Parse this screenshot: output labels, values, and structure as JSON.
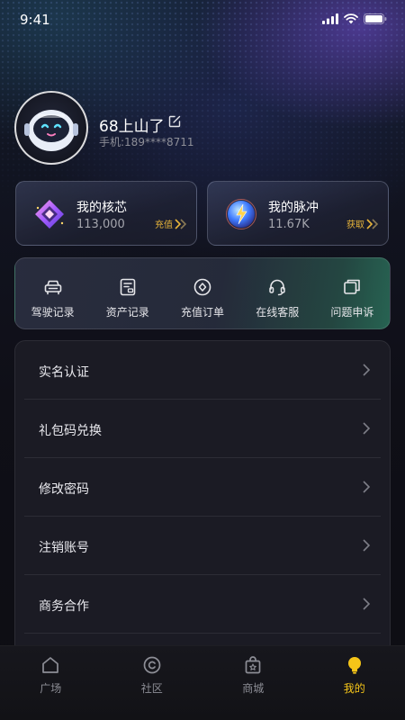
{
  "status_bar": {
    "time": "9:41"
  },
  "profile": {
    "username": "68上山了",
    "phone_label": "手机:",
    "phone_number": "189****8711"
  },
  "cards": [
    {
      "title": "我的核芯",
      "value": "113,000",
      "action": "充值",
      "icon": "core-crystal-icon"
    },
    {
      "title": "我的脉冲",
      "value": "11.67K",
      "action": "获取",
      "icon": "pulse-orb-icon"
    }
  ],
  "quick_actions": [
    {
      "label": "驾驶记录",
      "icon": "car-icon"
    },
    {
      "label": "资产记录",
      "icon": "document-icon"
    },
    {
      "label": "充值订单",
      "icon": "recharge-icon"
    },
    {
      "label": "在线客服",
      "icon": "headset-icon"
    },
    {
      "label": "问题申诉",
      "icon": "feedback-icon"
    }
  ],
  "menu": [
    {
      "label": "实名认证"
    },
    {
      "label": "礼包码兑换"
    },
    {
      "label": "修改密码"
    },
    {
      "label": "注销账号"
    },
    {
      "label": "商务合作"
    }
  ],
  "tabs": [
    {
      "label": "广场",
      "icon": "home-icon",
      "active": false
    },
    {
      "label": "社区",
      "icon": "community-icon",
      "active": false
    },
    {
      "label": "商城",
      "icon": "shop-icon",
      "active": false
    },
    {
      "label": "我的",
      "icon": "profile-bulb-icon",
      "active": true
    }
  ],
  "colors": {
    "accent": "#f5c518",
    "action_gold": "#e7b43a",
    "background": "#0d0d14",
    "menu_bg": "#1b1b24"
  }
}
